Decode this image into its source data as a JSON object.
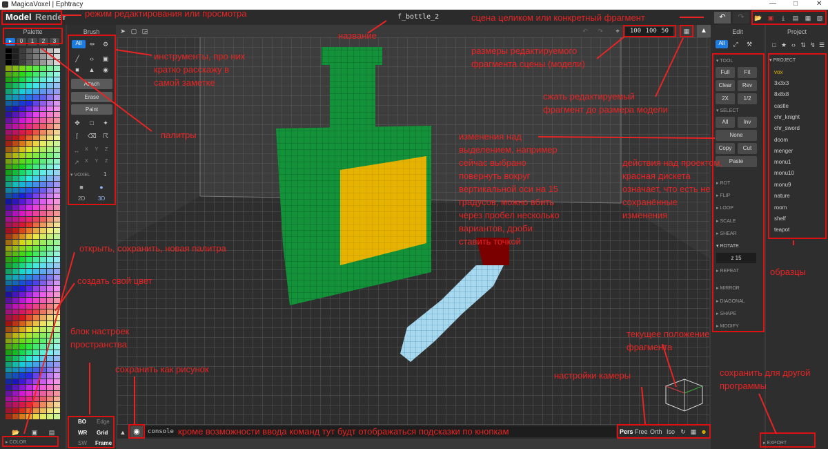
{
  "window": {
    "title": "MagicaVoxel | Ephtracy",
    "minimize_icon": "minimize-icon",
    "maximize_icon": "maximize-icon",
    "close_icon": "close-icon"
  },
  "modes": {
    "model": "Model",
    "render": "Render"
  },
  "scene_name": "f_bottle_2",
  "panels": {
    "palette": "Palette",
    "brush": "Brush",
    "edit": "Edit",
    "project": "Project"
  },
  "palette": {
    "tabs": [
      "▸",
      "0",
      "1",
      "2",
      "3"
    ],
    "color_section": "COLOR"
  },
  "brush": {
    "filter": "All",
    "modes": [
      "Attach",
      "Erase",
      "Paint"
    ],
    "axes_row1": [
      "X",
      "Y",
      "Z"
    ],
    "axes_row2": [
      "X",
      "Y",
      "Z"
    ],
    "voxel_section": "VOXEL",
    "voxel_value": "1",
    "view_2d": "2D",
    "view_3d": "3D"
  },
  "space_settings": [
    "BO",
    "Edge",
    "WR",
    "Grid",
    "SW",
    "Frame"
  ],
  "dimensions": {
    "x": "100",
    "y": "100",
    "z": "50"
  },
  "console": {
    "label": "console"
  },
  "camera": [
    "Pers",
    "Free",
    "Orth",
    "Iso"
  ],
  "edit": {
    "filter": "All",
    "tool_section": "TOOL",
    "tool_buttons": [
      "Full",
      "Fit",
      "Clear",
      "Rev",
      "2X",
      "1/2"
    ],
    "select_section": "SELECT",
    "select_buttons": [
      "All",
      "Inv",
      "None",
      "Copy",
      "Cut",
      "Paste"
    ],
    "sections": [
      "ROT",
      "FLIP",
      "LOOP",
      "SCALE",
      "SHEAR"
    ],
    "rotate_section": "ROTATE",
    "rotate_value": "z 15",
    "sections2": [
      "REPEAT",
      "MIRROR",
      "DIAGONAL",
      "SHAPE",
      "MODIFY"
    ]
  },
  "project": {
    "section": "PROJECT",
    "items": [
      "vox",
      "3x3x3",
      "8x8x8",
      "castle",
      "chr_knight",
      "chr_sword",
      "doom",
      "menger",
      "monu1",
      "monu10",
      "monu9",
      "nature",
      "room",
      "shelf",
      "teapot"
    ],
    "export": "EXPORT"
  },
  "annotations": {
    "mode": "режим редактирования или просмотра",
    "name": "название",
    "scene": "сцена целиком или конкретный фрагмент",
    "tools": [
      "инструменты, про них",
      "кратко расскажу в",
      "самой заметке"
    ],
    "size": [
      "размеры редактируемого",
      "фрагмента сцены (модели)"
    ],
    "shrink": [
      "сжать редактируемый",
      "фрагмент до размера модели"
    ],
    "palettes": "палитры",
    "selection": [
      "изменения над",
      "выделением, например",
      "сейчас выбрано",
      "повернуть вокруг",
      "вертикальной оси на 15",
      "градусов, можно вбить",
      "через пробел несколько",
      "вариантов, дроби",
      "ставить точкой"
    ],
    "project_actions": [
      "действия над проектом,",
      "красная дискета",
      "означает, что есть не",
      "сохранённые",
      "изменения"
    ],
    "open_save": "открыть, сохранить, новая палитра",
    "custom_color": "создать свой цвет",
    "space_block": [
      "блок настроек",
      "пространства"
    ],
    "samples": "образцы",
    "fragment_pos": [
      "текущее положение",
      "фрагмента"
    ],
    "save_image": "сохранить как рисунок",
    "camera": "настройки камеры",
    "export_other": [
      "сохранить для другой",
      "программы"
    ],
    "console_hint": "кроме возможности ввода команд тут будт отображаться подсказки по кнопкам"
  },
  "colors": {
    "accent": "#1e7ce0",
    "annotation": "#e82424",
    "bottle": "#14923a",
    "label": "#e6b400",
    "brush": "#a8d8ee",
    "save_red": "#e03030"
  }
}
